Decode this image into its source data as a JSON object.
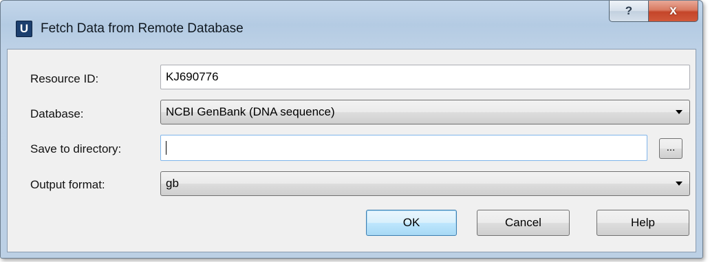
{
  "window": {
    "title": "Fetch Data from Remote Database",
    "app_icon_letter": "U",
    "help_glyph": "?",
    "close_glyph": "x"
  },
  "form": {
    "resource_id": {
      "label": "Resource ID:",
      "value": "KJ690776"
    },
    "database": {
      "label": "Database:",
      "value": "NCBI GenBank (DNA sequence)"
    },
    "save_dir": {
      "label": "Save to directory:",
      "value": "",
      "browse_label": "..."
    },
    "output_format": {
      "label": "Output format:",
      "value": "gb"
    }
  },
  "buttons": {
    "ok": "OK",
    "cancel": "Cancel",
    "help": "Help"
  }
}
